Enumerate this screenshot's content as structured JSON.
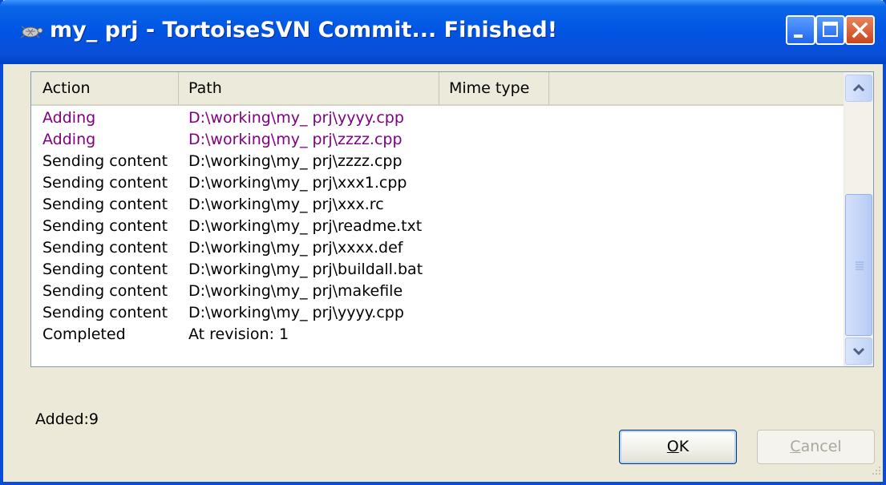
{
  "window": {
    "title": "my_ prj - TortoiseSVN Commit... Finished!",
    "controls": [
      "minimize-icon",
      "maximize-icon",
      "close-icon"
    ]
  },
  "list": {
    "columns": [
      "Action",
      "Path",
      "Mime type"
    ],
    "rows": [
      {
        "action": "Adding",
        "path": "D:\\working\\my_ prj\\yyyy.cpp",
        "type": "added"
      },
      {
        "action": "Adding",
        "path": "D:\\working\\my_ prj\\zzzz.cpp",
        "type": "added"
      },
      {
        "action": "Sending content",
        "path": "D:\\working\\my_ prj\\zzzz.cpp",
        "type": "normal"
      },
      {
        "action": "Sending content",
        "path": "D:\\working\\my_ prj\\xxx1.cpp",
        "type": "normal"
      },
      {
        "action": "Sending content",
        "path": "D:\\working\\my_ prj\\xxx.rc",
        "type": "normal"
      },
      {
        "action": "Sending content",
        "path": "D:\\working\\my_ prj\\readme.txt",
        "type": "normal"
      },
      {
        "action": "Sending content",
        "path": "D:\\working\\my_ prj\\xxxx.def",
        "type": "normal"
      },
      {
        "action": "Sending content",
        "path": "D:\\working\\my_ prj\\buildall.bat",
        "type": "normal"
      },
      {
        "action": "Sending content",
        "path": "D:\\working\\my_ prj\\makefile",
        "type": "normal"
      },
      {
        "action": "Sending content",
        "path": "D:\\working\\my_ prj\\yyyy.cpp",
        "type": "normal"
      },
      {
        "action": "Completed",
        "path": "At revision: 1",
        "type": "normal"
      }
    ]
  },
  "status": {
    "summary": "Added:9"
  },
  "buttons": {
    "ok_first": "O",
    "ok_rest": "K",
    "cancel_first": "C",
    "cancel_rest": "ancel"
  },
  "colors": {
    "added": "#800080",
    "normal": "#000000",
    "titlebar": "#0054e3"
  }
}
